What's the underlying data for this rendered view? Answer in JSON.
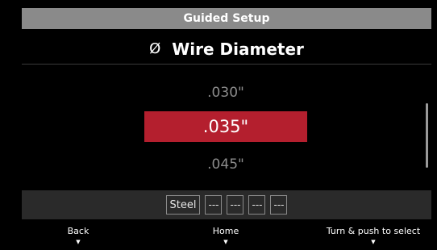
{
  "header": {
    "title": "Guided Setup"
  },
  "screen": {
    "title": "Wire Diameter",
    "icon": "diameter-icon",
    "icon_glyph": "Ø"
  },
  "options": [
    {
      "label": ".030\"",
      "selected": false
    },
    {
      "label": ".035\"",
      "selected": true
    },
    {
      "label": ".045\"",
      "selected": false
    }
  ],
  "summary": [
    "Steel",
    "---",
    "---",
    "---",
    "---"
  ],
  "footer": {
    "back_label": "Back",
    "home_label": "Home",
    "select_label": "Turn & push to select",
    "arrow_glyph": "▼"
  },
  "colors": {
    "header_bg": "#8a8a8a",
    "selected_bg": "#b41f2e",
    "summary_bg": "#2a2a2a",
    "background": "#000000"
  }
}
